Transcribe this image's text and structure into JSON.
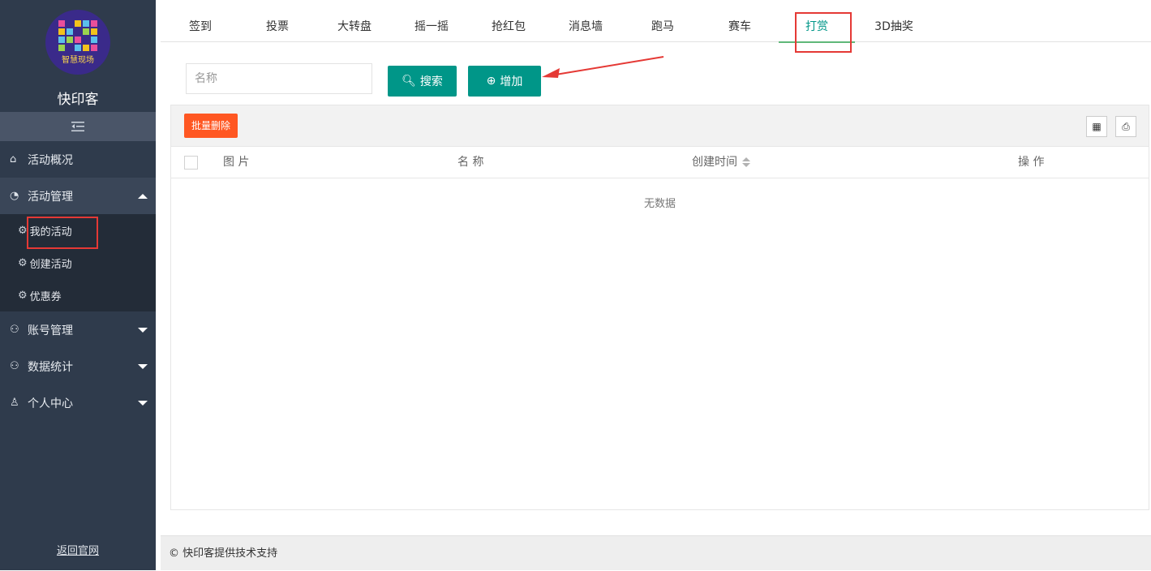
{
  "sidebar": {
    "logo_text": "智慧现场",
    "brand": "快印客",
    "collapse_icon": "indent-icon",
    "menu": [
      {
        "label": "活动概况",
        "icon": "home-icon"
      },
      {
        "label": "活动管理",
        "icon": "dashboard-icon",
        "expanded": true,
        "children": [
          {
            "label": "我的活动",
            "icon": "gear-icon"
          },
          {
            "label": "创建活动",
            "icon": "gear-icon"
          },
          {
            "label": "优惠券",
            "icon": "gear-icon"
          }
        ]
      },
      {
        "label": "账号管理",
        "icon": "users-icon"
      },
      {
        "label": "数据统计",
        "icon": "users-icon"
      },
      {
        "label": "个人中心",
        "icon": "user-icon"
      }
    ],
    "back_link": "返回官网"
  },
  "tabs": [
    "签到",
    "投票",
    "大转盘",
    "摇一摇",
    "抢红包",
    "消息墙",
    "跑马",
    "赛车",
    "打赏",
    "3D抽奖"
  ],
  "active_tab": "打赏",
  "search": {
    "placeholder": "名称",
    "value": ""
  },
  "buttons": {
    "search": "搜索",
    "add": "增加",
    "batch_delete": "批量删除"
  },
  "table": {
    "columns": [
      "图 片",
      "名 称",
      "创建时间",
      "操 作"
    ],
    "empty_text": "无数据"
  },
  "footer": "© 快印客提供技术支持",
  "colors": {
    "sidebar": "#2f3b4c",
    "primary": "#009688",
    "danger": "#ff5722",
    "highlight": "#e53935"
  }
}
